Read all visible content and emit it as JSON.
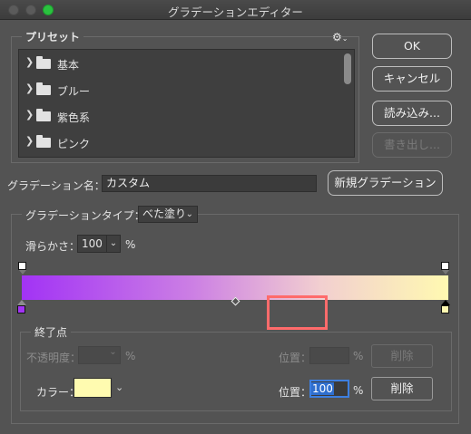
{
  "window": {
    "title": "グラデーションエディター"
  },
  "presets": {
    "label": "プリセット",
    "items": [
      {
        "label": "基本"
      },
      {
        "label": "ブルー"
      },
      {
        "label": "紫色系"
      },
      {
        "label": "ピンク"
      }
    ]
  },
  "buttons": {
    "ok": "OK",
    "cancel": "キャンセル",
    "load": "読み込み...",
    "export": "書き出し...",
    "new_gradient": "新規グラデーション"
  },
  "name": {
    "label": "グラデーション名：",
    "value": "カスタム"
  },
  "gradient_type": {
    "label": "グラデーションタイプ：",
    "value": "べた塗り"
  },
  "smoothness": {
    "label": "滑らかさ：",
    "value": "100",
    "unit": "%"
  },
  "gradient": {
    "start_color": "#a233f5",
    "end_color": "#fff9b1"
  },
  "stops": {
    "section_label": "終了点",
    "opacity_label": "不透明度：",
    "opacity_unit": "%",
    "opacity_position_label": "位置：",
    "opacity_position_unit": "%",
    "opacity_delete": "削除",
    "color_label": "カラー：",
    "color_value": "#fffbb0",
    "color_position_label": "位置：",
    "color_position_value": "100",
    "color_position_unit": "%",
    "color_delete": "削除"
  }
}
